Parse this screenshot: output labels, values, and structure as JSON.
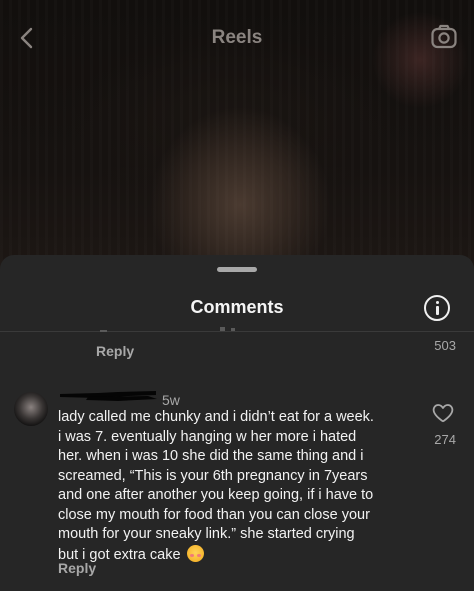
{
  "header": {
    "title": "Reels",
    "back_icon": "chevron-left-icon",
    "camera_icon": "camera-icon"
  },
  "comments_sheet": {
    "title": "Comments",
    "info_icon": "info-icon"
  },
  "previous_comment": {
    "reply_label": "Reply",
    "like_count": "503"
  },
  "comment": {
    "time_ago": "5w",
    "lines": [
      "lady called me chunky and i didn’t eat for a week.",
      "i was 7. eventually hanging w her more i hated",
      "her. when i was 10 she did the same thing and i",
      "screamed, “This is your 6th pregnancy in 7years",
      "and one after another you keep going, if i have to",
      "close my mouth for food than you can close your",
      "mouth for your sneaky link.” she started crying",
      "but i got extra cake"
    ],
    "emoji": "smiling-face-with-hearts-emoji",
    "reply_label": "Reply",
    "like_count": "274",
    "heart_icon": "heart-outline-icon"
  },
  "colors": {
    "sheet_background": "#262626",
    "primary_text": "#f2f2f2",
    "secondary_text": "#a8a8a8"
  }
}
